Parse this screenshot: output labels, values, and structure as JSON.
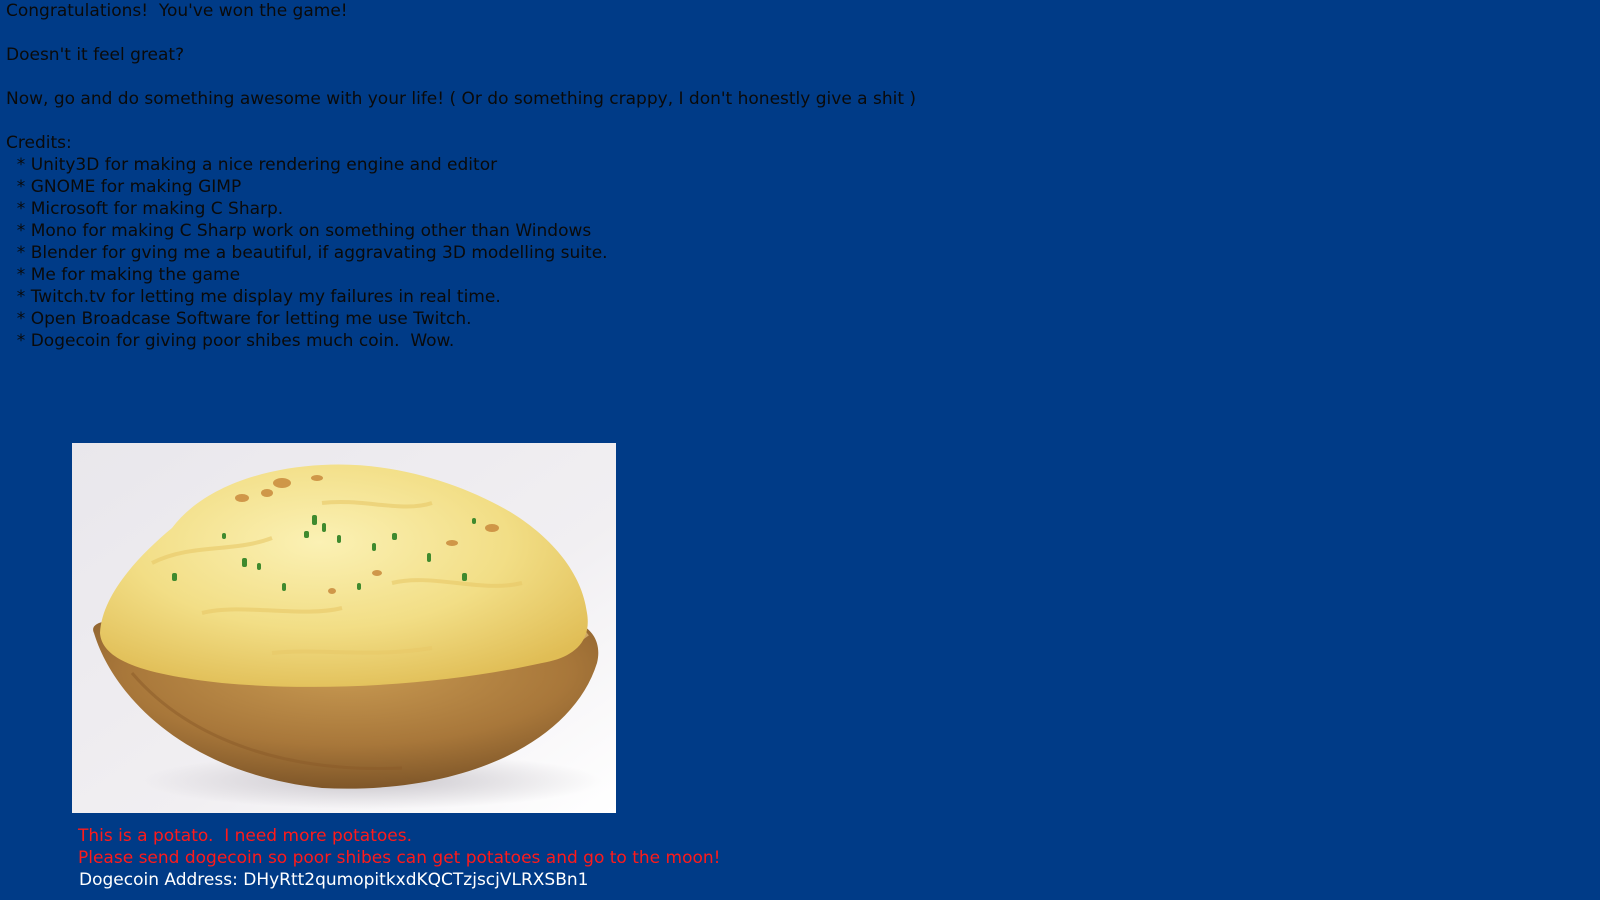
{
  "message": {
    "congrats": "Congratulations!  You've won the game!",
    "feel_great": "Doesn't it feel great?",
    "now_go": "Now, go and do something awesome with your life! ( Or do something crappy, I don't honestly give a shit )",
    "credits_heading": "Credits:"
  },
  "credits": [
    "  * Unity3D for making a nice rendering engine and editor",
    "  * GNOME for making GIMP",
    "  * Microsoft for making C Sharp.",
    "  * Mono for making C Sharp work on something other than Windows",
    "  * Blender for gving me a beautiful, if aggravating 3D modelling suite.",
    "  * Me for making the game",
    "  * Twitch.tv for letting me display my failures in real time.",
    "  * Open Broadcase Software for letting me use Twitch.",
    "  * Dogecoin for giving poor shibes much coin.  Wow."
  ],
  "potato": {
    "caption_line1": "This is a potato.  I need more potatoes.",
    "caption_line2": "Please send dogecoin so poor shibes can get potatoes and go to the moon!",
    "address": "Dogecoin Address: DHyRtt2qumopitkxdKQCTzjscjVLRXSBn1"
  },
  "colors": {
    "background": "#003b87",
    "text": "#0a0a0a",
    "caption_red": "#ff1a1a",
    "address_white": "#ffffff"
  }
}
